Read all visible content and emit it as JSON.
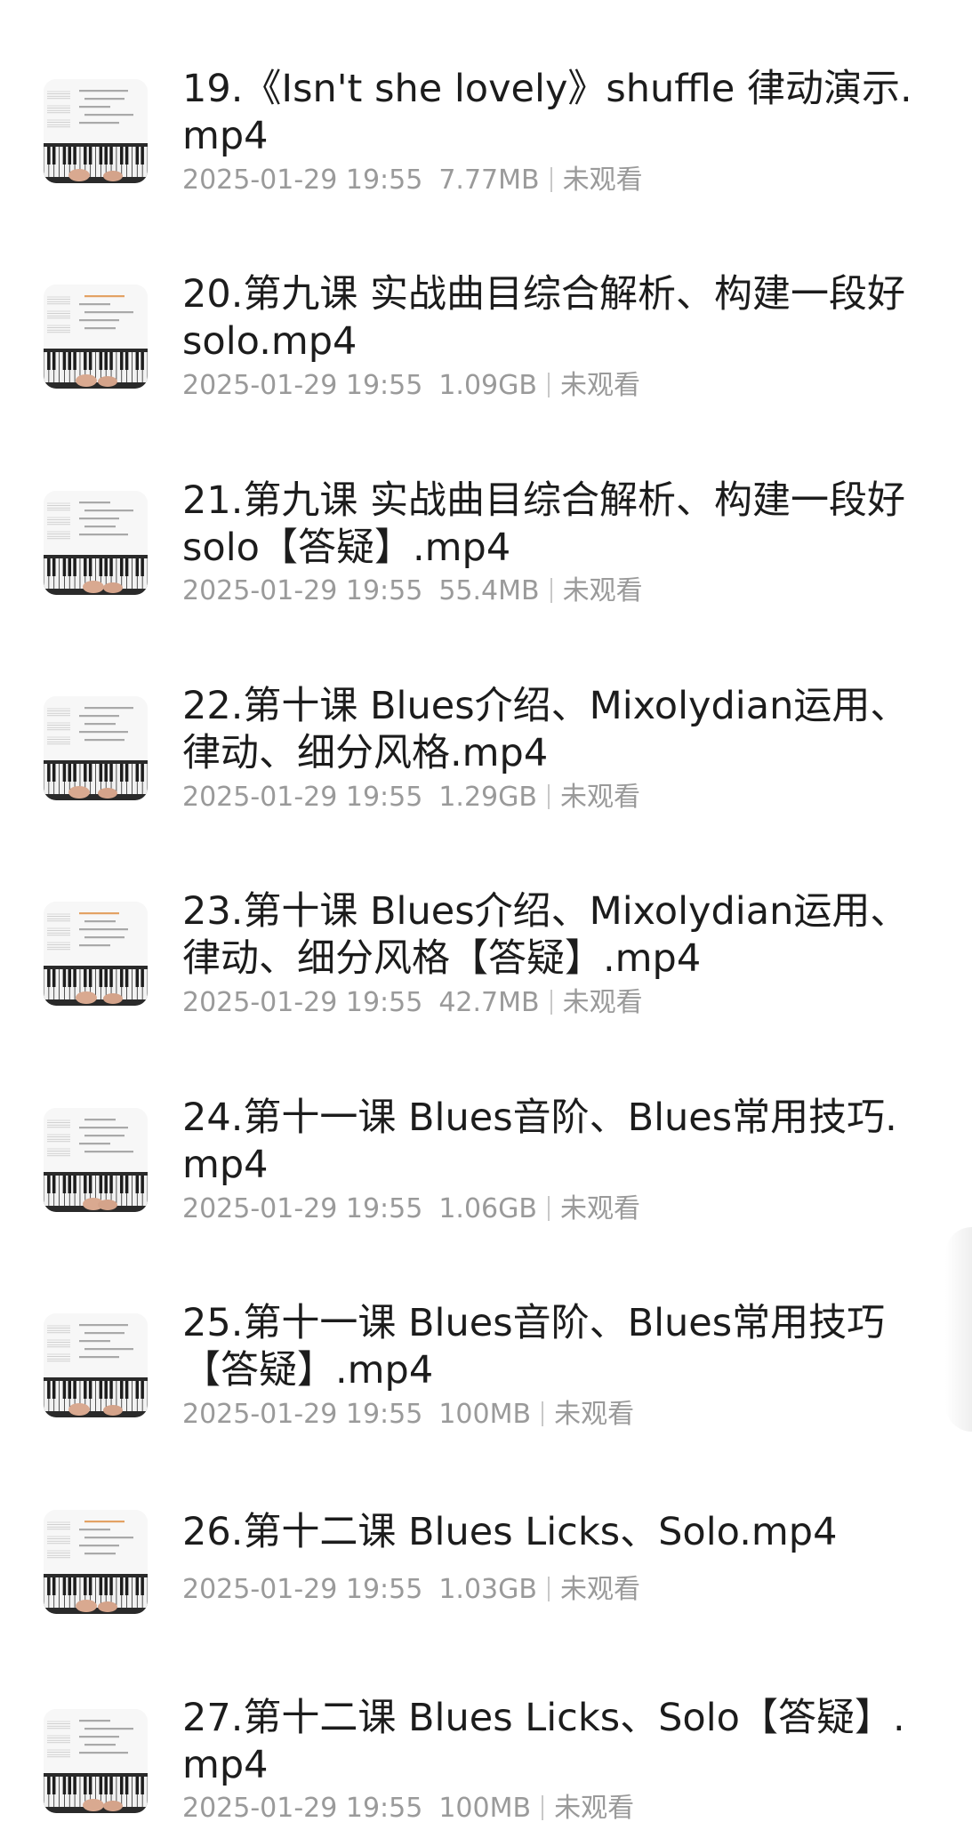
{
  "files": [
    {
      "name": "19.《Isn't she lovely》shuffle 律动演示.mp4",
      "date": "2025-01-29 19:55",
      "size": "7.77MB",
      "status": "未观看",
      "thumb_icon": "video-thumbnail-piano"
    },
    {
      "name": "20.第九课 实战曲目综合解析、构建一段好 solo.mp4",
      "date": "2025-01-29 19:55",
      "size": "1.09GB",
      "status": "未观看",
      "thumb_icon": "video-thumbnail-piano"
    },
    {
      "name": "21.第九课 实战曲目综合解析、构建一段好 solo【答疑】.mp4",
      "date": "2025-01-29 19:55",
      "size": "55.4MB",
      "status": "未观看",
      "thumb_icon": "video-thumbnail-piano"
    },
    {
      "name": "22.第十课 Blues介绍、Mixolydian运用、律动、细分风格.mp4",
      "date": "2025-01-29 19:55",
      "size": "1.29GB",
      "status": "未观看",
      "thumb_icon": "video-thumbnail-piano"
    },
    {
      "name": "23.第十课 Blues介绍、Mixolydian运用、律动、细分风格【答疑】.mp4",
      "date": "2025-01-29 19:55",
      "size": "42.7MB",
      "status": "未观看",
      "thumb_icon": "video-thumbnail-piano"
    },
    {
      "name": "24.第十一课 Blues音阶、Blues常用技巧.mp4",
      "date": "2025-01-29 19:55",
      "size": "1.06GB",
      "status": "未观看",
      "thumb_icon": "video-thumbnail-piano"
    },
    {
      "name": "25.第十一课 Blues音阶、Blues常用技巧【答疑】.mp4",
      "date": "2025-01-29 19:55",
      "size": "100MB",
      "status": "未观看",
      "thumb_icon": "video-thumbnail-piano"
    },
    {
      "name": "26.第十二课 Blues Licks、Solo.mp4",
      "date": "2025-01-29 19:55",
      "size": "1.03GB",
      "status": "未观看",
      "thumb_icon": "video-thumbnail-piano"
    },
    {
      "name": "27.第十二课 Blues Licks、Solo【答疑】.mp4",
      "date": "2025-01-29 19:55",
      "size": "100MB",
      "status": "未观看",
      "thumb_icon": "video-thumbnail-piano"
    }
  ],
  "colors": {
    "title": "#1c1c1c",
    "meta": "#9a9a9a",
    "background": "#ffffff"
  }
}
